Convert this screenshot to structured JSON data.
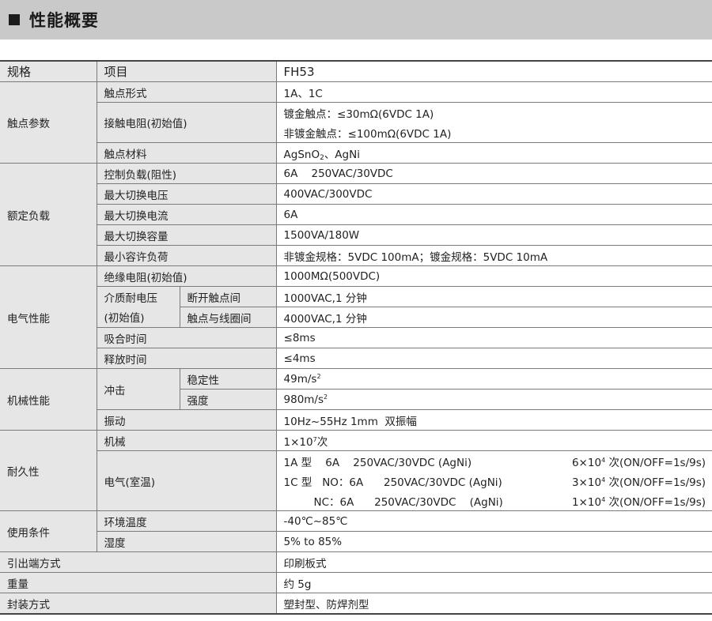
{
  "header": {
    "title": "性能概要"
  },
  "table": {
    "col_spec": "规格",
    "col_item": "项目",
    "col_model": "FH53",
    "contact": {
      "group": "触点参数",
      "form_label": "触点形式",
      "form_value": "1A、1C",
      "resistance_label": "接触电阻(初始值)",
      "resistance_gold": "镀金触点：≤30mΩ(6VDC 1A)",
      "resistance_nongold": "非镀金触点：≤100mΩ(6VDC 1A)",
      "material_label": "触点材料",
      "material_prefix": "AgSnO",
      "material_sub": "2",
      "material_suffix": "、AgNi"
    },
    "rated": {
      "group": "额定负载",
      "control_label": "控制负载(阻性)",
      "control_value": "6A    250VAC/30VDC",
      "max_voltage_label": "最大切换电压",
      "max_voltage_value": "400VAC/300VDC",
      "max_current_label": "最大切换电流",
      "max_current_value": "6A",
      "max_capacity_label": "最大切换容量",
      "max_capacity_value": "1500VA/180W",
      "min_load_label": "最小容许负荷",
      "min_load_value": "非镀金规格：5VDC 100mA；镀金规格：5VDC 10mA"
    },
    "electrical": {
      "group": "电气性能",
      "insulation_label": "绝缘电阻(初始值)",
      "insulation_value": "1000MΩ(500VDC)",
      "dielectric_label_1": "介质耐电压",
      "dielectric_label_2": "(初始值)",
      "open_contacts_label": "断开触点间",
      "open_contacts_value": "1000VAC,1 分钟",
      "contact_coil_label": "触点与线圈间",
      "contact_coil_value": "4000VAC,1 分钟",
      "operate_label": "吸合时间",
      "operate_value": "≤8ms",
      "release_label": "释放时间",
      "release_value": "≤4ms"
    },
    "mechanical": {
      "group": "机械性能",
      "shock_label": "冲击",
      "stability_label": "稳定性",
      "stability_value": "49m/s",
      "strength_label": "强度",
      "strength_value": "980m/s",
      "unit_exp": "2",
      "vibration_label": "振动",
      "vibration_value": "10Hz~55Hz 1mm  双振幅"
    },
    "endurance": {
      "group": "耐久性",
      "mech_label": "机械",
      "mech_prefix": "1×10",
      "mech_exp": "7",
      "mech_suffix": "次",
      "elec_label": "电气(室温)",
      "line1_left": "1A 型    6A    250VAC/30VDC (AgNi)",
      "line1_right_prefix": "6×10",
      "line2_left": "1C 型   NO：6A      250VAC/30VDC (AgNi)",
      "line2_right_prefix": "3×10",
      "line3_left": "NC：6A      250VAC/30VDC    (AgNi)",
      "line3_right_prefix": "1×10",
      "right_exp": "4",
      "right_suffix": " 次(ON/OFF=1s/9s)"
    },
    "usage": {
      "group": "使用条件",
      "temp_label": "环境温度",
      "temp_value": "-40℃~85℃",
      "humidity_label": "湿度",
      "humidity_value": "5% to 85%"
    },
    "terminal_label": "引出端方式",
    "terminal_value": "印刷板式",
    "weight_label": "重量",
    "weight_value": "约 5g",
    "package_label": "封装方式",
    "package_value": "塑封型、防焊剂型"
  }
}
